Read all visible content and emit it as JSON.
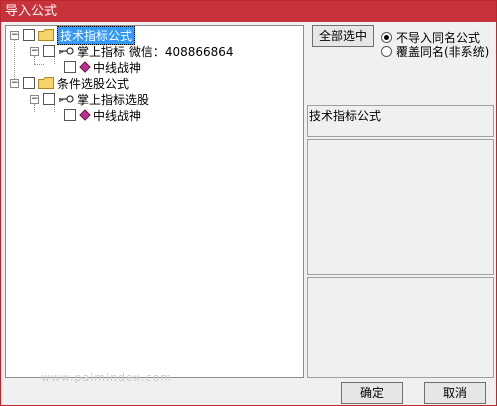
{
  "window": {
    "title": "导入公式"
  },
  "tree": {
    "nodes": [
      {
        "label": "技术指标公式",
        "level": 0,
        "selected": true
      },
      {
        "label": "掌上指标  微信：408866864",
        "level": 1
      },
      {
        "label": "中线战神",
        "level": 2
      },
      {
        "label": "条件选股公式",
        "level": 0
      },
      {
        "label": "掌上指标选股",
        "level": 1
      },
      {
        "label": "中线战神",
        "level": 2
      }
    ]
  },
  "controls": {
    "select_all_label": "全部选中",
    "radio_options": [
      {
        "label": "不导入同名公式",
        "checked": true
      },
      {
        "label": "覆盖同名(非系统)",
        "checked": false
      }
    ]
  },
  "info_panel": {
    "category_label": "技术指标公式"
  },
  "footer": {
    "ok_label": "确定",
    "cancel_label": "取消",
    "watermark": "www.palmindex.com"
  },
  "colors": {
    "titlebar": "#c8323a",
    "selection": "#3399ff"
  }
}
